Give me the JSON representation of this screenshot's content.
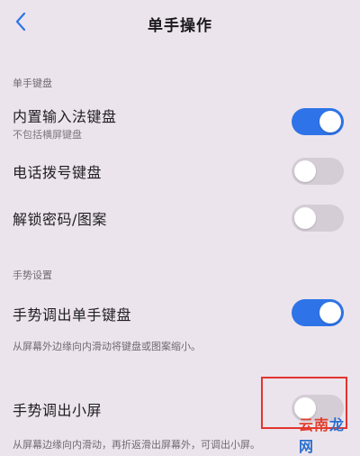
{
  "header": {
    "title": "单手操作",
    "back_icon": "chevron-left-icon"
  },
  "colors": {
    "background": "#ece4ec",
    "toggle_on": "#2e74e8",
    "toggle_off": "#d5cdd6",
    "highlight": "#e2352f"
  },
  "sections": {
    "keyboard": {
      "title": "单手键盘",
      "items": [
        {
          "label": "内置输入法键盘",
          "sub": "不包括横屏键盘",
          "state": "on"
        },
        {
          "label": "电话拨号键盘",
          "state": "off"
        },
        {
          "label": "解锁密码/图案",
          "state": "off"
        }
      ]
    },
    "gesture": {
      "title": "手势设置",
      "items": [
        {
          "label": "手势调出单手键盘",
          "desc": "从屏幕外边缘向内滑动将键盘或图案缩小。",
          "state": "on"
        },
        {
          "label": "手势调出小屏",
          "desc": "从屏幕边缘向内滑动，再折返滑出屏幕外，可调出小屏。",
          "state": "off"
        }
      ]
    }
  },
  "watermark": {
    "part1": "云南",
    "part2": "龙网"
  }
}
